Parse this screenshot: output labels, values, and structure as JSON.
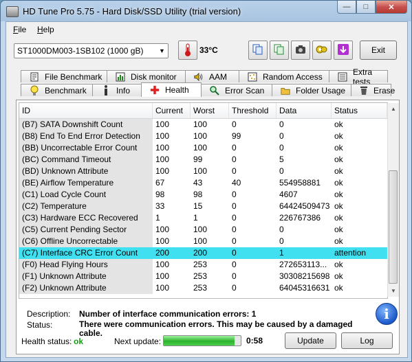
{
  "window": {
    "title": "HD Tune Pro 5.75 - Hard Disk/SSD Utility (trial version)"
  },
  "caption_buttons": {
    "minimize": "—",
    "maximize": "□",
    "close": "✕"
  },
  "menu": [
    {
      "label": "File",
      "key": "F",
      "rest": "ile"
    },
    {
      "label": "Help",
      "key": "H",
      "rest": "elp"
    }
  ],
  "toolbar": {
    "drive": "ST1000DM003-1SB102 (1000 gB)",
    "temperature": "33°C",
    "exit_label": "Exit",
    "icons": [
      "copy-info-icon",
      "copy-text-icon",
      "screenshot-icon",
      "options-icon",
      "save-icon"
    ]
  },
  "tabs_row1": [
    {
      "label": "File Benchmark",
      "icon": "file-benchmark-icon"
    },
    {
      "label": "Disk monitor",
      "icon": "disk-monitor-icon"
    },
    {
      "label": "AAM",
      "icon": "speaker-icon"
    },
    {
      "label": "Random Access",
      "icon": "random-access-icon"
    },
    {
      "label": "Extra tests",
      "icon": "extra-tests-icon"
    }
  ],
  "tabs_row2": [
    {
      "label": "Benchmark",
      "icon": "lightbulb-icon"
    },
    {
      "label": "Info",
      "icon": "info-icon"
    },
    {
      "label": "Health",
      "icon": "health-cross-icon",
      "active": true
    },
    {
      "label": "Error Scan",
      "icon": "magnifier-icon"
    },
    {
      "label": "Folder Usage",
      "icon": "folder-icon"
    },
    {
      "label": "Erase",
      "icon": "trash-icon"
    }
  ],
  "table": {
    "columns": [
      "ID",
      "Current",
      "Worst",
      "Threshold",
      "Data",
      "Status"
    ],
    "rows": [
      [
        "(B7) SATA Downshift Count",
        "100",
        "100",
        "0",
        "0",
        "ok"
      ],
      [
        "(B8) End To End Error Detection",
        "100",
        "100",
        "99",
        "0",
        "ok"
      ],
      [
        "(BB) Uncorrectable Error Count",
        "100",
        "100",
        "0",
        "0",
        "ok"
      ],
      [
        "(BC) Command Timeout",
        "100",
        "99",
        "0",
        "5",
        "ok"
      ],
      [
        "(BD) Unknown Attribute",
        "100",
        "100",
        "0",
        "0",
        "ok"
      ],
      [
        "(BE) Airflow Temperature",
        "67",
        "43",
        "40",
        "554958881",
        "ok"
      ],
      [
        "(C1) Load Cycle Count",
        "98",
        "98",
        "0",
        "4607",
        "ok"
      ],
      [
        "(C2) Temperature",
        "33",
        "15",
        "0",
        "64424509473",
        "ok"
      ],
      [
        "(C3) Hardware ECC Recovered",
        "1",
        "1",
        "0",
        "226767386",
        "ok"
      ],
      [
        "(C5) Current Pending Sector",
        "100",
        "100",
        "0",
        "0",
        "ok"
      ],
      [
        "(C6) Offline Uncorrectable",
        "100",
        "100",
        "0",
        "0",
        "ok"
      ],
      [
        "(C7) Interface CRC Error Count",
        "200",
        "200",
        "0",
        "1",
        "attention"
      ],
      [
        "(F0) Head Flying Hours",
        "100",
        "253",
        "0",
        "272653113...",
        "ok"
      ],
      [
        "(F1) Unknown Attribute",
        "100",
        "253",
        "0",
        "30308215698",
        "ok"
      ],
      [
        "(F2) Unknown Attribute",
        "100",
        "253",
        "0",
        "64045316631",
        "ok"
      ]
    ],
    "selected_row": 11
  },
  "details": {
    "description_label": "Description:",
    "description_value": "Number of interface communication errors: 1",
    "status_label": "Status:",
    "status_value": "There were communication errors. This may be caused by a damaged cable."
  },
  "footer": {
    "health_label": "Health status:",
    "health_value": "ok",
    "next_update_label": "Next update:",
    "progress_fraction": 0.92,
    "countdown": "0:58",
    "update_label": "Update",
    "log_label": "Log"
  },
  "colors": {
    "selected_row": "#40e0f0",
    "ok_status": "#1a9a1a",
    "progress": "#2db32d"
  }
}
